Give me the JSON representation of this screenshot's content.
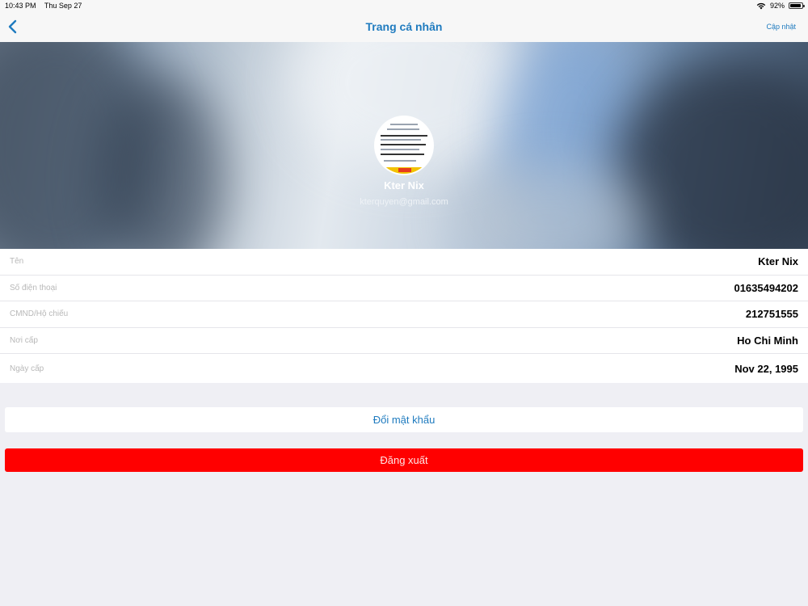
{
  "status_bar": {
    "time": "10:43 PM",
    "date": "Thu Sep 27",
    "battery_text": "92%",
    "battery_level": 0.92,
    "wifi_icon": "wifi-icon",
    "battery_icon": "battery-icon"
  },
  "nav": {
    "back_icon": "chevron-left-icon",
    "title": "Trang cá nhân",
    "update_label": "Cập nhật"
  },
  "profile": {
    "name": "Kter Nix",
    "email": "kterquyen@gmail.com"
  },
  "info": [
    {
      "label": "Tên",
      "value": "Kter Nix"
    },
    {
      "label": "Số điện thoại",
      "value": "01635494202"
    },
    {
      "label": "CMND/Hộ chiếu",
      "value": "212751555"
    },
    {
      "label": "Nơi cấp",
      "value": "Ho Chi Minh"
    },
    {
      "label": "Ngày cấp",
      "value": "Nov 22, 1995"
    }
  ],
  "actions": {
    "change_password": "Đổi mật khẩu",
    "logout": "Đăng xuất"
  },
  "colors": {
    "accent": "#1f7bbf",
    "logout": "#ff0000",
    "background": "#efeff4"
  }
}
